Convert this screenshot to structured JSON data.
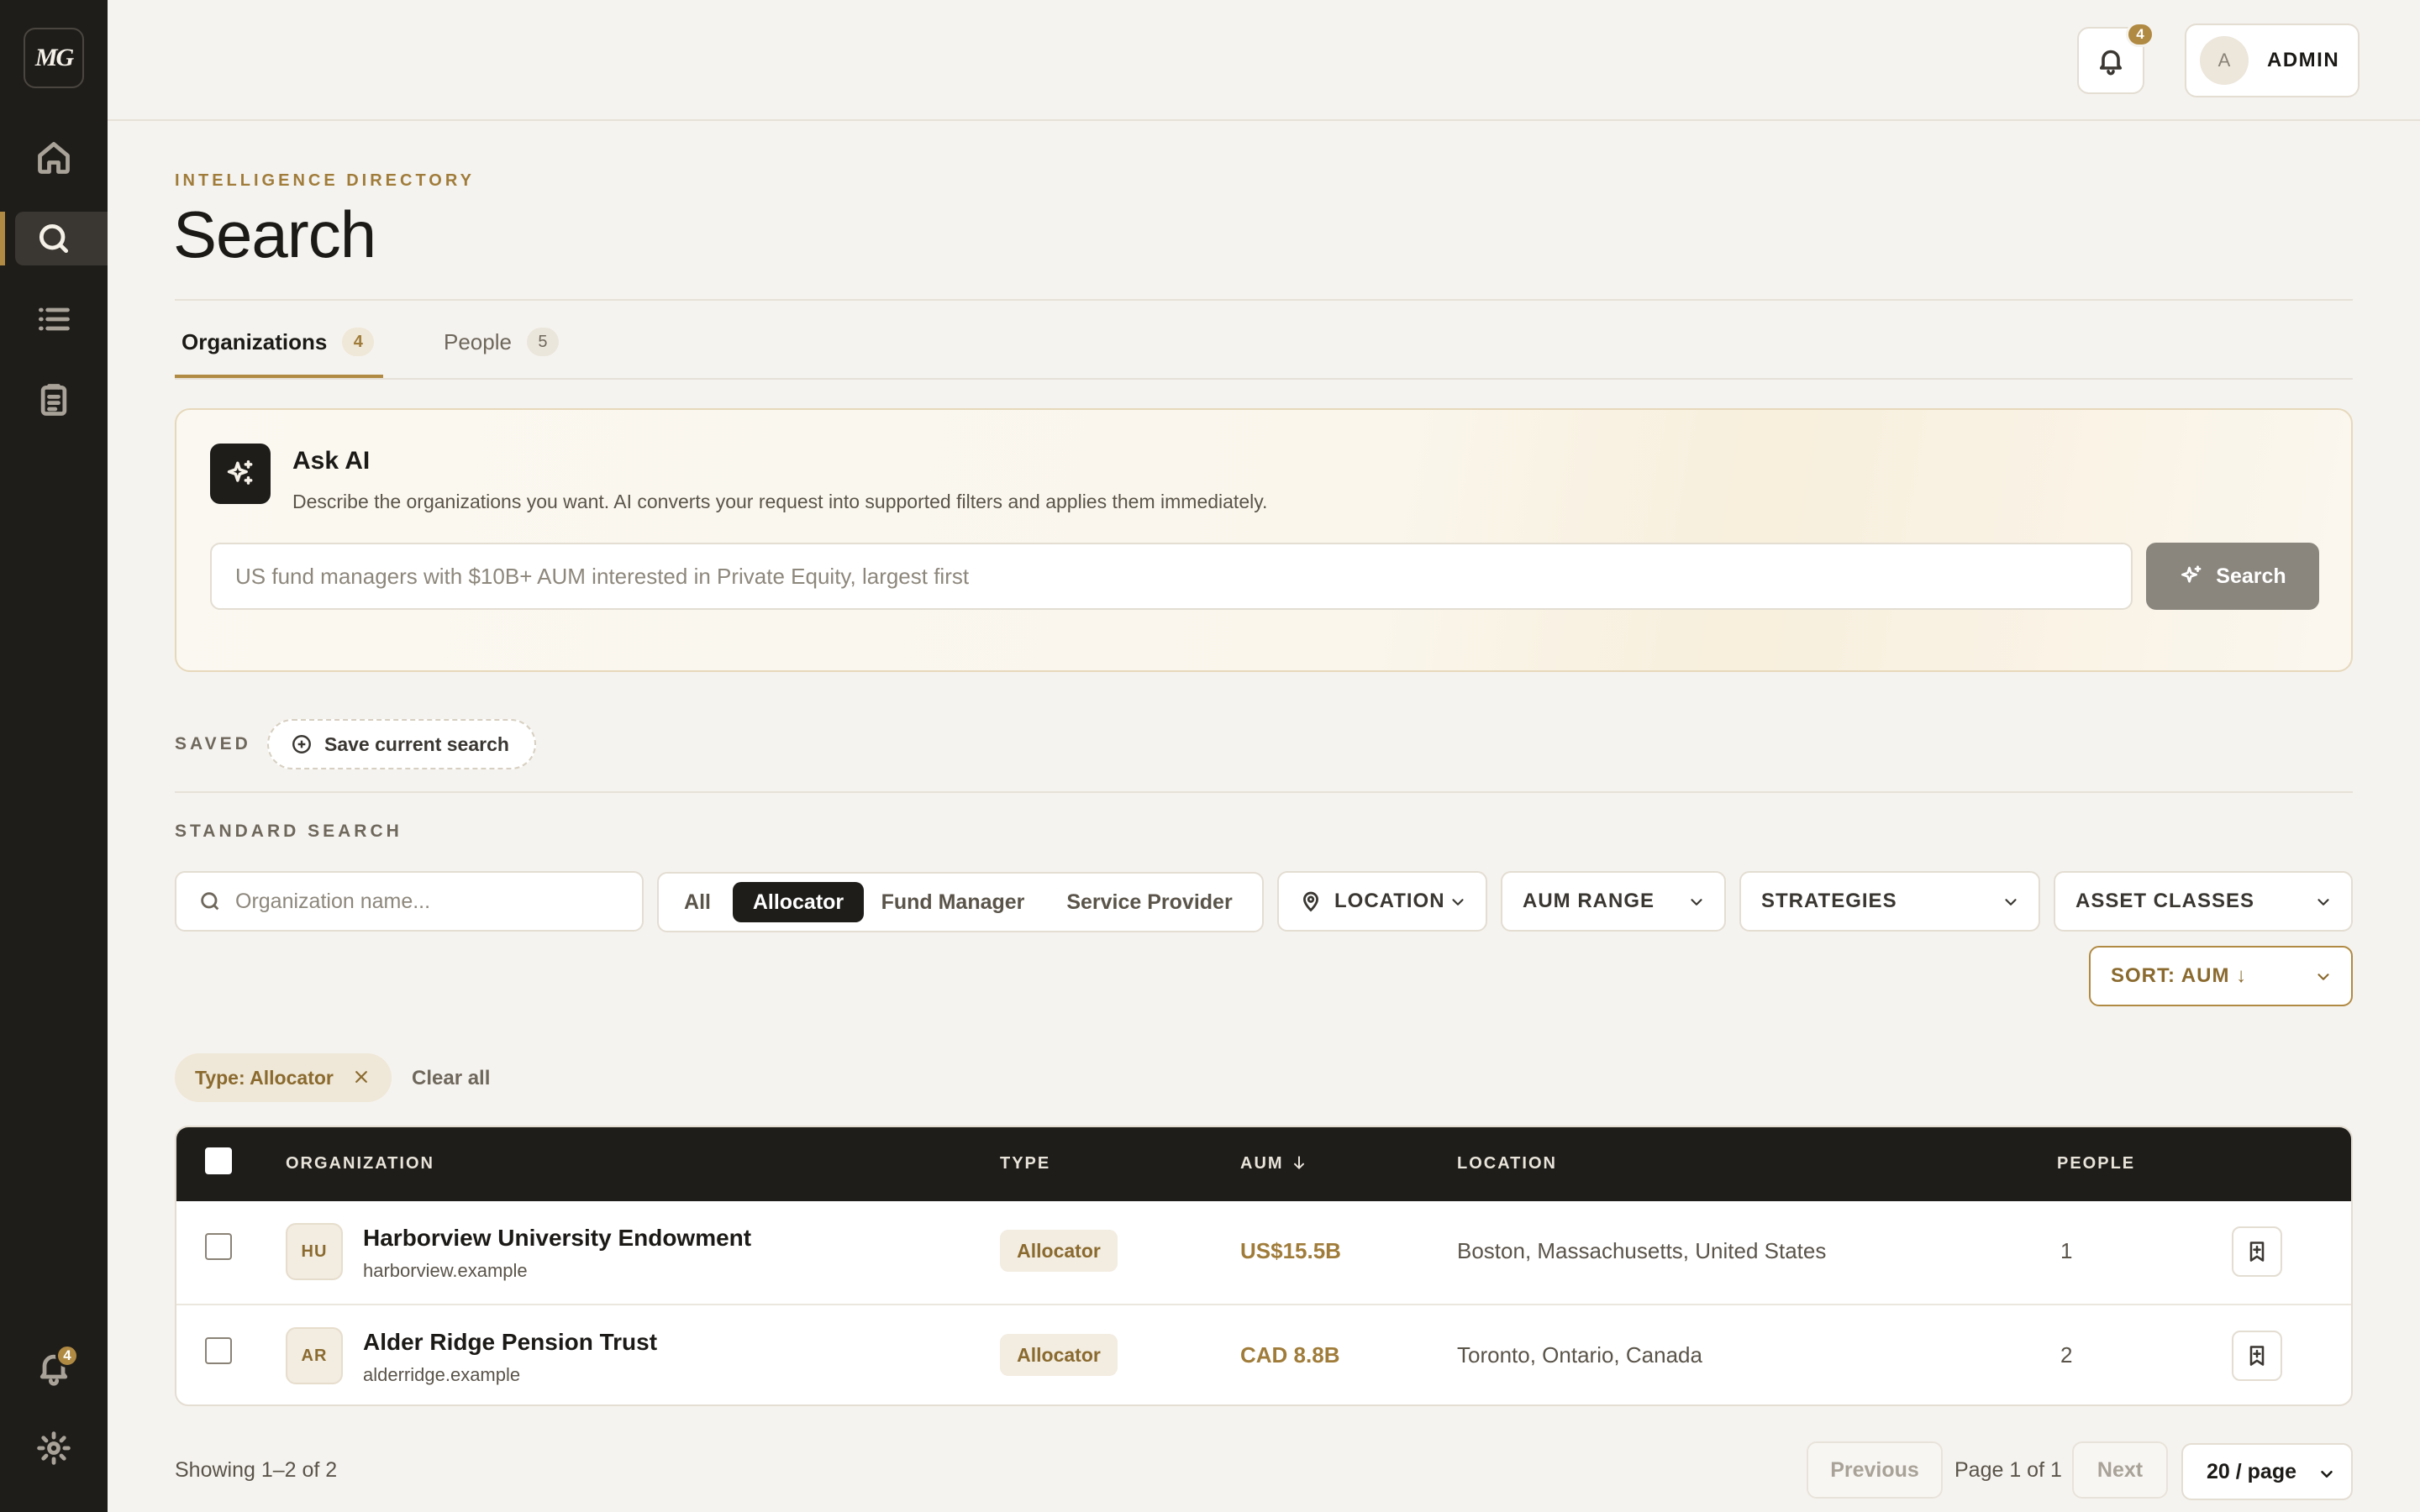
{
  "sidebar": {
    "logo": "MG",
    "items": [
      {
        "name": "home",
        "icon": "home-icon"
      },
      {
        "name": "search",
        "icon": "search-icon",
        "active": true
      },
      {
        "name": "lists",
        "icon": "list-icon"
      },
      {
        "name": "reports",
        "icon": "clipboard-icon"
      }
    ],
    "notifications_badge": "4",
    "settings_icon": "gear-icon"
  },
  "topbar": {
    "notifications_badge": "4",
    "user_initial": "A",
    "user_name": "ADMIN"
  },
  "header": {
    "eyebrow": "INTELLIGENCE DIRECTORY",
    "title": "Search"
  },
  "tabs": [
    {
      "label": "Organizations",
      "count": "4",
      "active": true
    },
    {
      "label": "People",
      "count": "5",
      "active": false
    }
  ],
  "ask_ai": {
    "title": "Ask AI",
    "description": "Describe the organizations you want. AI converts your request into supported filters and applies them immediately.",
    "placeholder": "US fund managers with $10B+ AUM interested in Private Equity, largest first",
    "button_label": "Search"
  },
  "saved": {
    "label": "SAVED",
    "save_button": "Save current search"
  },
  "standard_search": {
    "label": "STANDARD SEARCH",
    "name_placeholder": "Organization name...",
    "type_options": [
      "All",
      "Allocator",
      "Fund Manager",
      "Service Provider"
    ],
    "type_selected": "Allocator",
    "filters": {
      "location": "LOCATION",
      "aum_range": "AUM RANGE",
      "strategies": "STRATEGIES",
      "asset_classes": "ASSET CLASSES"
    },
    "sort": "SORT: AUM ↓"
  },
  "active_filters": {
    "chips": [
      "Type: Allocator"
    ],
    "clear_all": "Clear all"
  },
  "table": {
    "columns": [
      "ORGANIZATION",
      "TYPE",
      "AUM",
      "LOCATION",
      "PEOPLE"
    ],
    "rows": [
      {
        "initials": "HU",
        "name": "Harborview University Endowment",
        "domain": "harborview.example",
        "type": "Allocator",
        "aum": "US$15.5B",
        "location": "Boston, Massachusetts, United States",
        "people": "1"
      },
      {
        "initials": "AR",
        "name": "Alder Ridge Pension Trust",
        "domain": "alderridge.example",
        "type": "Allocator",
        "aum": "CAD 8.8B",
        "location": "Toronto, Ontario, Canada",
        "people": "2"
      }
    ]
  },
  "pagination": {
    "showing": "Showing 1–2 of 2",
    "previous": "Previous",
    "page_info": "Page 1 of 1",
    "next": "Next",
    "per_page": "20 / page"
  },
  "colors": {
    "accent": "#b08a42",
    "sidebar_bg": "#1f1d1a",
    "page_bg": "#f5f3ef"
  }
}
